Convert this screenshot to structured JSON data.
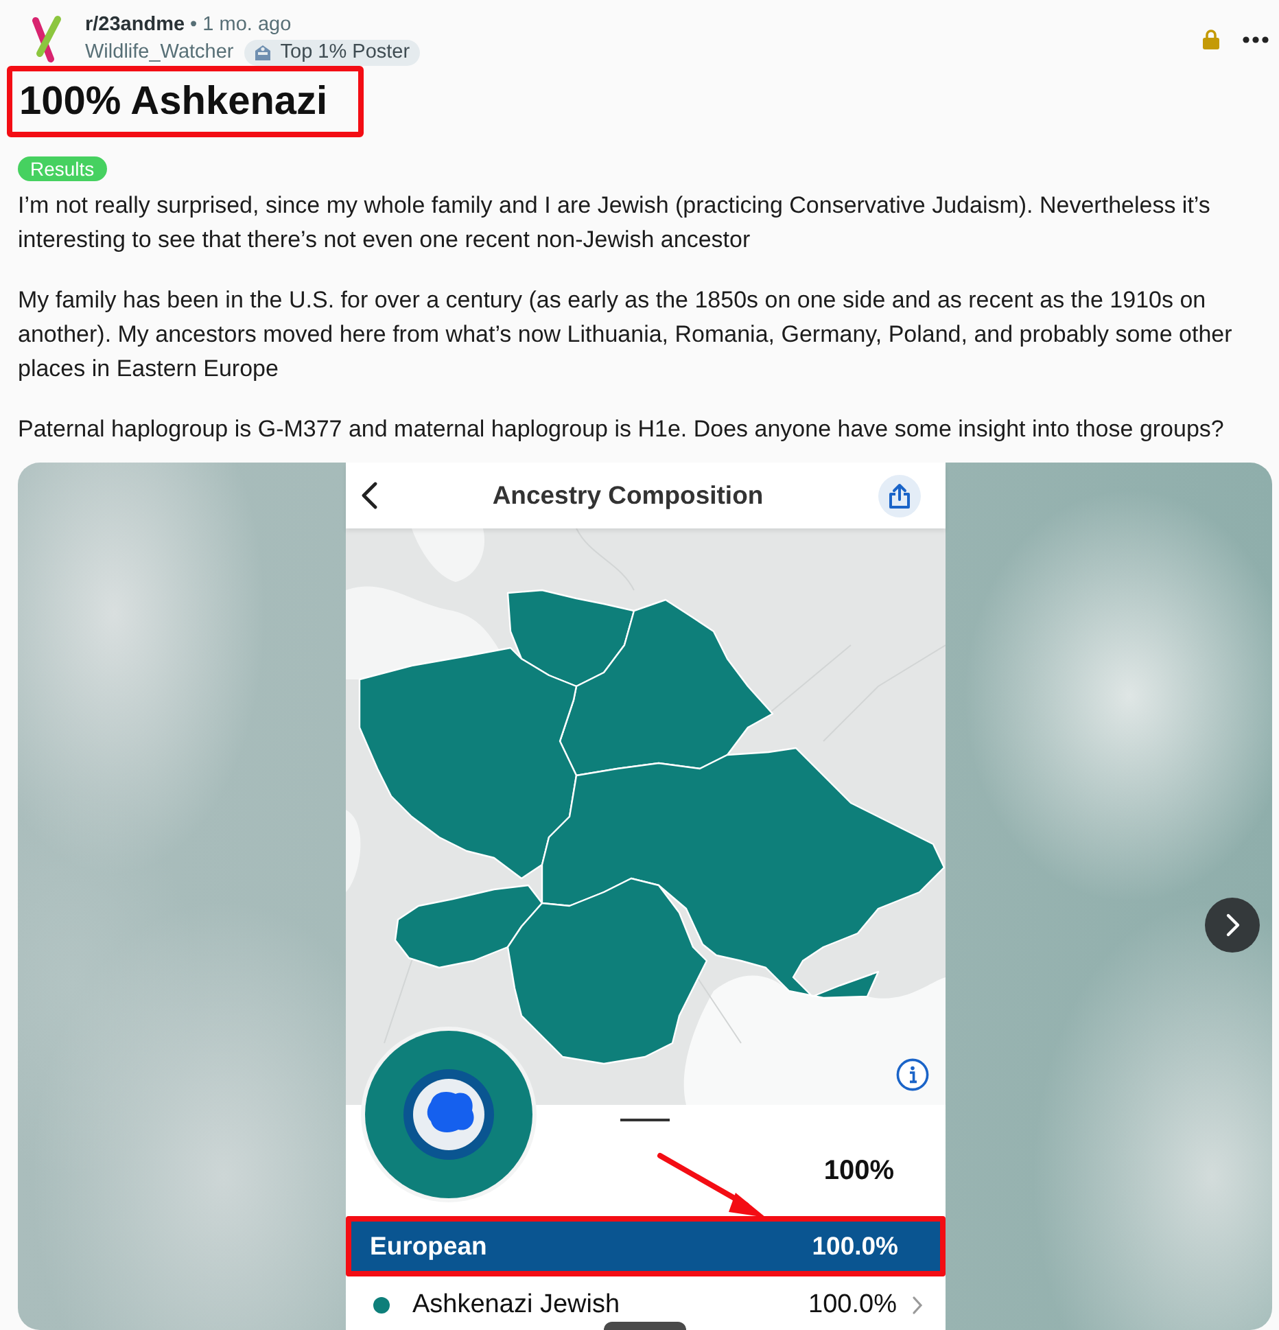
{
  "post": {
    "subreddit": "r/23andme",
    "separator": "•",
    "age": "1 mo. ago",
    "author": "Wildlife_Watcher",
    "author_flair": "Top 1% Poster",
    "locked": true,
    "title": {
      "text": "100% Ashkenazi",
      "highlighted": true
    },
    "flair": {
      "text": "Results",
      "color": "#46d160"
    },
    "paragraphs": [
      "I’m not really surprised, since my whole family and I are Jewish (practicing Conservative Judaism). Nevertheless it’s interesting to see that there’s not even one recent non-Jewish ancestor",
      "My family has been in the U.S. for over a century (as early as the 1850s on one side and as recent as the 1910s on another). My ancestors moved here from what’s now Lithuania, Romania, Germany, Poland, and probably some other places in Eastern Europe",
      "Paternal haplogroup is G-M377 and maternal haplogroup is H1e. Does anyone have some insight into those groups?"
    ]
  },
  "gallery": {
    "has_next": true,
    "screenshot": {
      "title": "Ancestry Composition",
      "total": "100%",
      "rows": [
        {
          "kind": "region",
          "name": "European",
          "percent": "100.0%",
          "highlighted": true
        },
        {
          "kind": "population",
          "name": "Ashkenazi Jewish",
          "percent": "100.0%",
          "color": "#0e7f7a"
        }
      ]
    }
  }
}
